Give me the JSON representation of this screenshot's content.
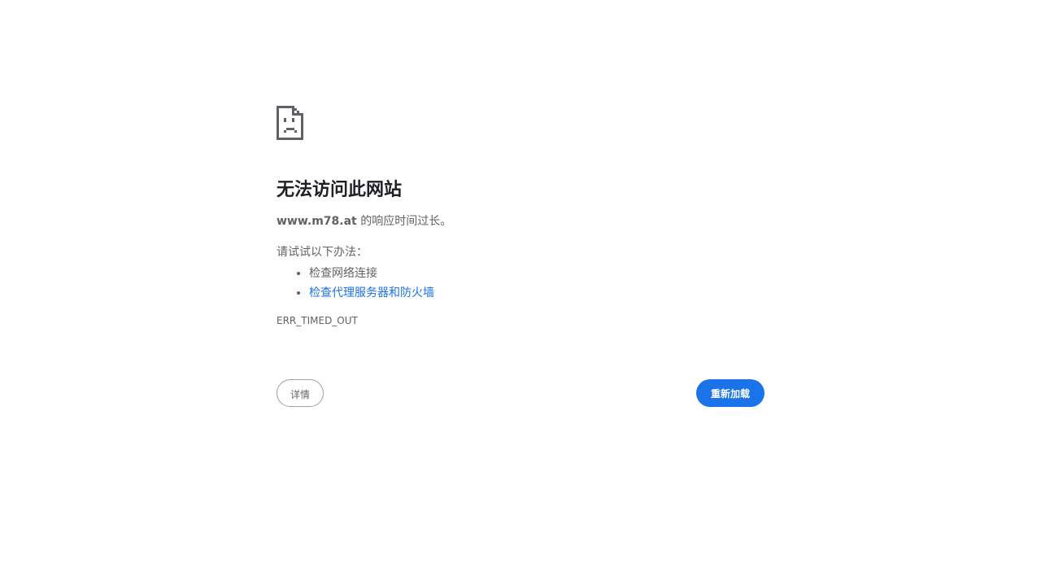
{
  "error": {
    "icon": "sad-page-icon",
    "title": "无法访问此网站",
    "host": "www.m78.at",
    "summary_suffix": " 的响应时间过长。",
    "suggestions_heading": "请试试以下办法：",
    "suggestions": [
      {
        "label": "检查网络连接",
        "is_link": false
      },
      {
        "label": "检查代理服务器和防火墙",
        "is_link": true
      }
    ],
    "code": "ERR_TIMED_OUT"
  },
  "buttons": {
    "details_label": "详情",
    "reload_label": "重新加载"
  },
  "colors": {
    "text": "#5f6368",
    "heading": "#202124",
    "link": "#1a73e8",
    "primary_button": "#1a73e8"
  }
}
